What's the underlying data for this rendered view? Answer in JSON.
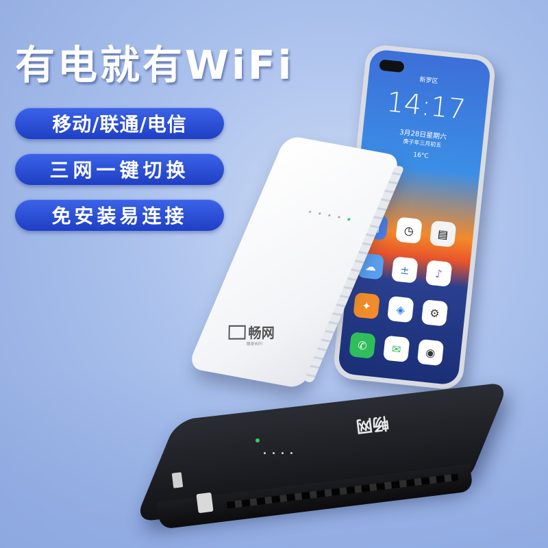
{
  "headline": "有电就有WiFi",
  "features": [
    "移动/联通/电信",
    "三网一键切换",
    "免安装易连接"
  ],
  "phone": {
    "location": "新罗区",
    "time": "14:17",
    "date": "3月28日星期六",
    "lunar": "庚子年三月初五",
    "weather": "16°C"
  },
  "router_white": {
    "brand": "畅网",
    "sub": "随身WiFi"
  },
  "router_black": {
    "brand": "畅网"
  }
}
